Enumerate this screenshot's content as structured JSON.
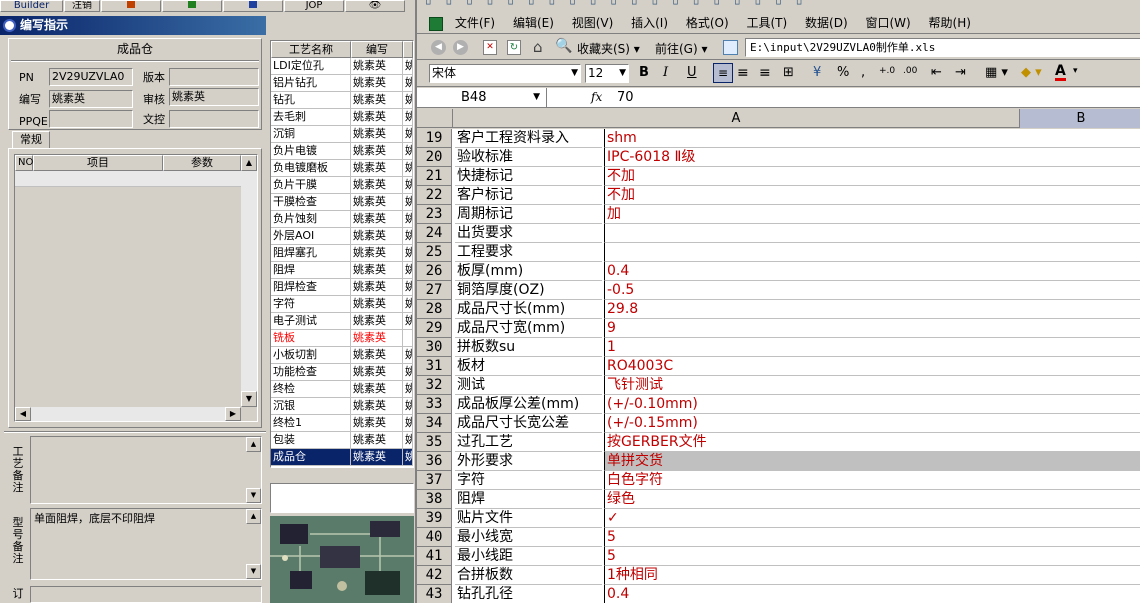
{
  "topbar": {
    "builder": "Builder",
    "logout": "注销",
    "jop": "JOP"
  },
  "form": {
    "title": "编写指示",
    "panel_title": "成品仓",
    "pn_label": "PN",
    "pn_value": "2V29UZVLA0",
    "version_label": "版本",
    "version_value": "",
    "writer_label": "编写",
    "writer_value": "姚素英",
    "reviewer_label": "审核",
    "reviewer_value": "姚素英",
    "ppqe_label": "PPQE",
    "ppqe_value": "",
    "doc_label": "文控",
    "doc_value": "",
    "tab_label": "常规",
    "grid_headers": {
      "no": "NO",
      "item": "项目",
      "param": "参数"
    },
    "process_note_label": "工艺备注",
    "model_note_label": "型号备注",
    "model_note_value": "单面阻焊，底层不印阻焊",
    "order_label": "订"
  },
  "process_list": {
    "headers": {
      "name": "工艺名称",
      "writer": "编写"
    },
    "rows": [
      {
        "name": "LDI定位孔",
        "writer": "姚素英",
        "extra": "姚",
        "state": "normal"
      },
      {
        "name": "铝片钻孔",
        "writer": "姚素英",
        "extra": "姚",
        "state": "normal"
      },
      {
        "name": "钻孔",
        "writer": "姚素英",
        "extra": "姚",
        "state": "normal"
      },
      {
        "name": "去毛刺",
        "writer": "姚素英",
        "extra": "姚",
        "state": "normal"
      },
      {
        "name": "沉铜",
        "writer": "姚素英",
        "extra": "姚",
        "state": "normal"
      },
      {
        "name": "负片电镀",
        "writer": "姚素英",
        "extra": "姚",
        "state": "normal"
      },
      {
        "name": "负电镀磨板",
        "writer": "姚素英",
        "extra": "姚",
        "state": "normal"
      },
      {
        "name": "负片干膜",
        "writer": "姚素英",
        "extra": "姚",
        "state": "normal"
      },
      {
        "name": "干膜检查",
        "writer": "姚素英",
        "extra": "姚",
        "state": "normal"
      },
      {
        "name": "负片蚀刻",
        "writer": "姚素英",
        "extra": "姚",
        "state": "normal"
      },
      {
        "name": "外层AOI",
        "writer": "姚素英",
        "extra": "姚",
        "state": "normal"
      },
      {
        "name": "阻焊塞孔",
        "writer": "姚素英",
        "extra": "姚",
        "state": "normal"
      },
      {
        "name": "阻焊",
        "writer": "姚素英",
        "extra": "姚",
        "state": "normal"
      },
      {
        "name": "阻焊检查",
        "writer": "姚素英",
        "extra": "姚",
        "state": "normal"
      },
      {
        "name": "字符",
        "writer": "姚素英",
        "extra": "姚",
        "state": "normal"
      },
      {
        "name": "电子测试",
        "writer": "姚素英",
        "extra": "姚",
        "state": "normal"
      },
      {
        "name": "铣板",
        "writer": "姚素英",
        "extra": "",
        "state": "red"
      },
      {
        "name": "小板切割",
        "writer": "姚素英",
        "extra": "姚",
        "state": "normal"
      },
      {
        "name": "功能检查",
        "writer": "姚素英",
        "extra": "姚",
        "state": "normal"
      },
      {
        "name": "终检",
        "writer": "姚素英",
        "extra": "姚",
        "state": "normal"
      },
      {
        "name": "沉银",
        "writer": "姚素英",
        "extra": "姚",
        "state": "normal"
      },
      {
        "name": "终检1",
        "writer": "姚素英",
        "extra": "姚",
        "state": "normal"
      },
      {
        "name": "包装",
        "writer": "姚素英",
        "extra": "姚",
        "state": "normal"
      },
      {
        "name": "成品仓",
        "writer": "姚素英",
        "extra": "姚",
        "state": "selected"
      }
    ]
  },
  "excel": {
    "menu": [
      "文件(F)",
      "编辑(E)",
      "视图(V)",
      "插入(I)",
      "格式(O)",
      "工具(T)",
      "数据(D)",
      "窗口(W)",
      "帮助(H)"
    ],
    "favorites_label": "收藏夹(S)",
    "goto_label": "前往(G)",
    "path": "E:\\input\\2V29UZVLA0制作单.xls",
    "font_name": "宋体",
    "font_size": "12",
    "name_box": "B48",
    "formula_value": "70",
    "col_a": "A",
    "col_b": "B",
    "rows": [
      {
        "n": "19",
        "a": "客户工程资料录入",
        "b": "shm"
      },
      {
        "n": "20",
        "a": "验收标准",
        "b": "IPC-6018 Ⅱ级"
      },
      {
        "n": "21",
        "a": "快捷标记",
        "b": "不加"
      },
      {
        "n": "22",
        "a": "客户标记",
        "b": "不加"
      },
      {
        "n": "23",
        "a": "周期标记",
        "b": "加"
      },
      {
        "n": "24",
        "a": "出货要求",
        "b": ""
      },
      {
        "n": "25",
        "a": "工程要求",
        "b": ""
      },
      {
        "n": "26",
        "a": "板厚(mm)",
        "b": "0.4"
      },
      {
        "n": "27",
        "a": "铜箔厚度(OZ)",
        "b": "-0.5"
      },
      {
        "n": "28",
        "a": "成品尺寸长(mm)",
        "b": "29.8"
      },
      {
        "n": "29",
        "a": "成品尺寸宽(mm)",
        "b": "9"
      },
      {
        "n": "30",
        "a": "拼板数su",
        "b": "1"
      },
      {
        "n": "31",
        "a": "板材",
        "b": "RO4003C"
      },
      {
        "n": "32",
        "a": "测试",
        "b": "飞针测试"
      },
      {
        "n": "33",
        "a": "成品板厚公差(mm)",
        "b": "(+/-0.10mm)"
      },
      {
        "n": "34",
        "a": "成品尺寸长宽公差",
        "b": "(+/-0.15mm)"
      },
      {
        "n": "35",
        "a": "过孔工艺",
        "b": "按GERBER文件"
      },
      {
        "n": "36",
        "a": "外形要求",
        "b": "单拼交货"
      },
      {
        "n": "37",
        "a": "字符",
        "b": "白色字符"
      },
      {
        "n": "38",
        "a": "阻焊",
        "b": "绿色"
      },
      {
        "n": "39",
        "a": "贴片文件",
        "b": "✓"
      },
      {
        "n": "40",
        "a": "最小线宽",
        "b": "5"
      },
      {
        "n": "41",
        "a": "最小线距",
        "b": "5"
      },
      {
        "n": "42",
        "a": "合拼板数",
        "b": "1种相同"
      },
      {
        "n": "43",
        "a": "钻孔孔径",
        "b": "0.4"
      }
    ]
  },
  "colors": {
    "title_bar": "#0a246a",
    "selected_row": "#0a246a",
    "red_text": "#c00000",
    "highlight_row": "#c0c0c0"
  }
}
